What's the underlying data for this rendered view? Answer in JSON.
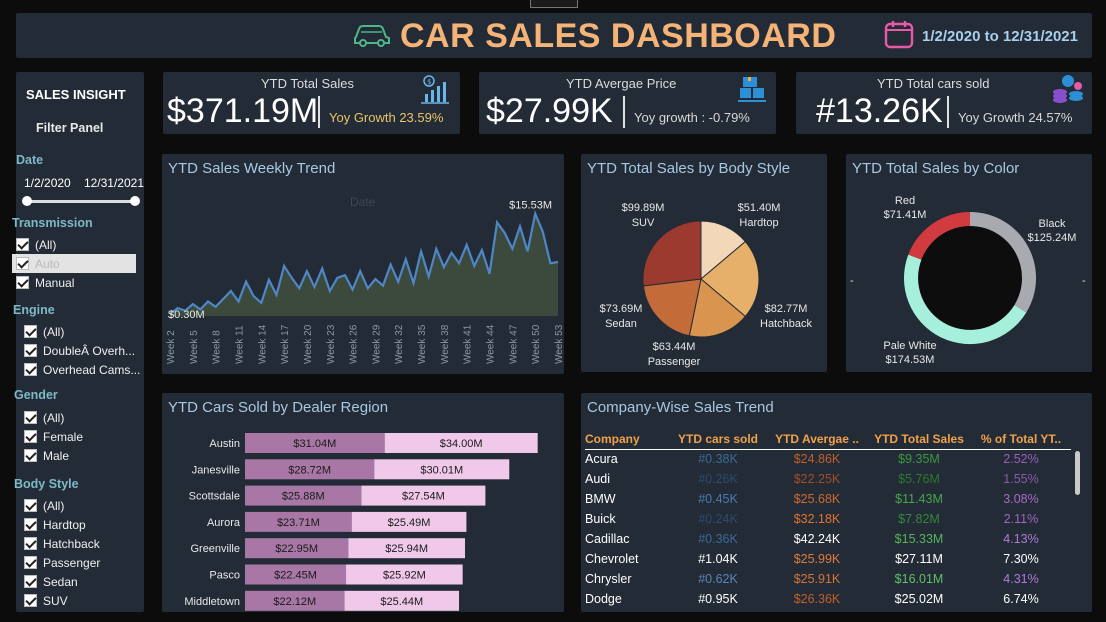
{
  "header": {
    "title": "CAR SALES DASHBOARD",
    "date_range": "1/2/2020 to 12/31/2021",
    "colors": {
      "title": "#f5b377",
      "date": "#a8cfee"
    }
  },
  "sidebar": {
    "title": "SALES INSIGHT",
    "subtitle": "Filter Panel",
    "date": {
      "heading": "Date",
      "start": "1/2/2020",
      "end": "12/31/2021"
    },
    "transmission": {
      "heading": "Transmission",
      "items": [
        "(All)",
        "Auto",
        "Manual"
      ]
    },
    "engine": {
      "heading": "Engine",
      "items": [
        "(All)",
        "DoubleÂ Overh...",
        "Overhead Cams..."
      ]
    },
    "gender": {
      "heading": "Gender",
      "items": [
        "(All)",
        "Female",
        "Male"
      ]
    },
    "body_style": {
      "heading": "Body Style",
      "items": [
        "(All)",
        "Hardtop",
        "Hatchback",
        "Passenger",
        "Sedan",
        "SUV"
      ]
    }
  },
  "kpis": [
    {
      "label": "YTD Total Sales",
      "value": "$371.19M",
      "growth": "Yoy Growth 23.59%",
      "growth_color": "#e8c46a",
      "icon": "bar-chart-dollar-icon"
    },
    {
      "label": "YTD Avergae Price",
      "value": "$27.99K",
      "growth": "Yoy growth : -0.79%",
      "growth_color": "#d8d8d8",
      "icon": "boxes-icon"
    },
    {
      "label": "YTD Total cars sold",
      "value": "#13.26K",
      "growth": "Yoy Growth 24.57%",
      "growth_color": "#d8d8d8",
      "icon": "coins-icon"
    }
  ],
  "trend": {
    "title": "YTD Sales Weekly Trend",
    "ghost_label": "Date",
    "min_label": "$0.30M",
    "max_label": "$15.53M"
  },
  "body_style_chart": {
    "title": "YTD Total Sales by Body Style"
  },
  "color_chart": {
    "title": "YTD Total Sales by Color"
  },
  "dealer_chart": {
    "title": "YTD Cars Sold by Dealer Region"
  },
  "company": {
    "title": "Company-Wise Sales Trend",
    "columns": [
      "Company",
      "YTD cars sold",
      "YTD Avergae ..",
      "YTD Total Sales",
      "% of Total YT.."
    ],
    "column_colors": [
      "#ffffff",
      "#5b86b8",
      "#e07b3c",
      "#58b35c",
      "#b07ad6"
    ],
    "rows": [
      [
        "Acura",
        "#0.38K",
        "$24.86K",
        "$9.35M",
        "2.52%"
      ],
      [
        "Audi",
        "#0.26K",
        "$22.25K",
        "$5.76M",
        "1.55%"
      ],
      [
        "BMW",
        "#0.45K",
        "$25.68K",
        "$11.43M",
        "3.08%"
      ],
      [
        "Buick",
        "#0.24K",
        "$32.18K",
        "$7.82M",
        "2.11%"
      ],
      [
        "Cadillac",
        "#0.36K",
        "$42.24K",
        "$15.33M",
        "4.13%"
      ],
      [
        "Chevrolet",
        "#1.04K",
        "$25.99K",
        "$27.11M",
        "7.30%"
      ],
      [
        "Chrysler",
        "#0.62K",
        "$25.91K",
        "$16.01M",
        "4.31%"
      ],
      [
        "Dodge",
        "#0.95K",
        "$26.36K",
        "$25.02M",
        "6.74%"
      ]
    ],
    "cell_colors": [
      [
        "#ffffff",
        "#3d6b98",
        "#c45e2a",
        "#3a9a3f",
        "#9a5fbd"
      ],
      [
        "#ffffff",
        "#2b4d70",
        "#a34d26",
        "#2a7a30",
        "#8c5aa8"
      ],
      [
        "#ffffff",
        "#4a7cb0",
        "#d06a30",
        "#46a84b",
        "#a66bc7"
      ],
      [
        "#ffffff",
        "#2b4d70",
        "#e0742e",
        "#34883a",
        "#a066c2"
      ],
      [
        "#ffffff",
        "#3d6b98",
        "#ffffff",
        "#58b35c",
        "#b07ad6"
      ],
      [
        "#ffffff",
        "#ffffff",
        "#e07b3c",
        "#ffffff",
        "#ffffff"
      ],
      [
        "#ffffff",
        "#5b86b8",
        "#d87434",
        "#62c066",
        "#b07ad6"
      ],
      [
        "#ffffff",
        "#ffffff",
        "#c45e2a",
        "#ffffff",
        "#ffffff"
      ]
    ]
  },
  "chart_data": [
    {
      "type": "area",
      "title": "YTD Sales Weekly Trend",
      "x": [
        "Week 2",
        "Week 3",
        "Week 4",
        "Week 5",
        "Week 6",
        "Week 7",
        "Week 8",
        "Week 9",
        "Week 10",
        "Week 11",
        "Week 12",
        "Week 13",
        "Week 14",
        "Week 15",
        "Week 16",
        "Week 17",
        "Week 18",
        "Week 19",
        "Week 20",
        "Week 21",
        "Week 22",
        "Week 23",
        "Week 24",
        "Week 25",
        "Week 26",
        "Week 27",
        "Week 28",
        "Week 29",
        "Week 30",
        "Week 31",
        "Week 32",
        "Week 33",
        "Week 34",
        "Week 35",
        "Week 36",
        "Week 37",
        "Week 38",
        "Week 39",
        "Week 40",
        "Week 41",
        "Week 42",
        "Week 43",
        "Week 44",
        "Week 45",
        "Week 46",
        "Week 47",
        "Week 48",
        "Week 49",
        "Week 50",
        "Week 51",
        "Week 52",
        "Week 53"
      ],
      "x_tick_labels": [
        "Week 2",
        "Week 5",
        "Week 8",
        "Week 11",
        "Week 14",
        "Week 17",
        "Week 20",
        "Week 23",
        "Week 26",
        "Week 29",
        "Week 32",
        "Week 35",
        "Week 38",
        "Week 41",
        "Week 44",
        "Week 47",
        "Week 50",
        "Week 53"
      ],
      "series": [
        {
          "values": [
            0.3,
            1.2,
            0.8,
            1.8,
            1.0,
            2.2,
            1.4,
            2.6,
            3.8,
            2.2,
            5.2,
            3.0,
            2.0,
            5.5,
            3.2,
            7.6,
            5.8,
            4.2,
            6.8,
            4.4,
            7.2,
            3.8,
            5.8,
            6.2,
            4.0,
            6.8,
            4.2,
            5.6,
            4.6,
            7.8,
            5.2,
            8.6,
            5.0,
            9.8,
            6.0,
            10.2,
            7.4,
            9.6,
            8.0,
            10.8,
            7.6,
            10.0,
            6.4,
            14.2,
            12.6,
            10.2,
            13.6,
            9.8,
            15.53,
            12.8,
            8.0,
            8.2
          ]
        }
      ],
      "min_label": "$0.30M",
      "max_label": "$15.53M",
      "colors": {
        "line": "#4f86c6",
        "fill": "#3b4a3c"
      }
    },
    {
      "type": "pie",
      "title": "YTD Total Sales by Body Style",
      "categories": [
        "Hardtop",
        "Hatchback",
        "Passenger",
        "Sedan",
        "SUV"
      ],
      "values": [
        51.4,
        82.77,
        63.44,
        73.69,
        99.89
      ],
      "value_labels": [
        "$51.40M",
        "$82.77M",
        "$63.44M",
        "$73.69M",
        "$99.89M"
      ],
      "colors": [
        "#f2d8b8",
        "#e6b06a",
        "#d9944f",
        "#c46b3a",
        "#9c3a30"
      ]
    },
    {
      "type": "pie",
      "title": "YTD Total Sales by Color",
      "categories": [
        "Black",
        "Pale White",
        "Red"
      ],
      "values": [
        125.24,
        174.53,
        71.41
      ],
      "value_labels": [
        "$125.24M",
        "$174.53M",
        "$71.41M"
      ],
      "colors": [
        "#a8aab0",
        "#a6f0db",
        "#d13a3f"
      ]
    },
    {
      "type": "bar",
      "title": "YTD Cars Sold by Dealer Region",
      "categories": [
        "Austin",
        "Janesville",
        "Scottsdale",
        "Aurora",
        "Greenville",
        "Pasco",
        "Middletown"
      ],
      "series": [
        {
          "values": [
            31.04,
            28.72,
            25.88,
            23.71,
            22.95,
            22.45,
            22.12
          ],
          "labels": [
            "$31.04M",
            "$28.72M",
            "$25.88M",
            "$23.71M",
            "$22.95M",
            "$22.45M",
            "$22.12M"
          ]
        },
        {
          "values": [
            34.0,
            30.01,
            27.54,
            25.49,
            25.94,
            25.92,
            25.44
          ],
          "labels": [
            "$34.00M",
            "$30.01M",
            "$27.54M",
            "$25.49M",
            "$25.94M",
            "$25.92M",
            "$25.44M"
          ]
        }
      ],
      "colors": [
        "#a877a6",
        "#f0c8ea"
      ]
    }
  ]
}
